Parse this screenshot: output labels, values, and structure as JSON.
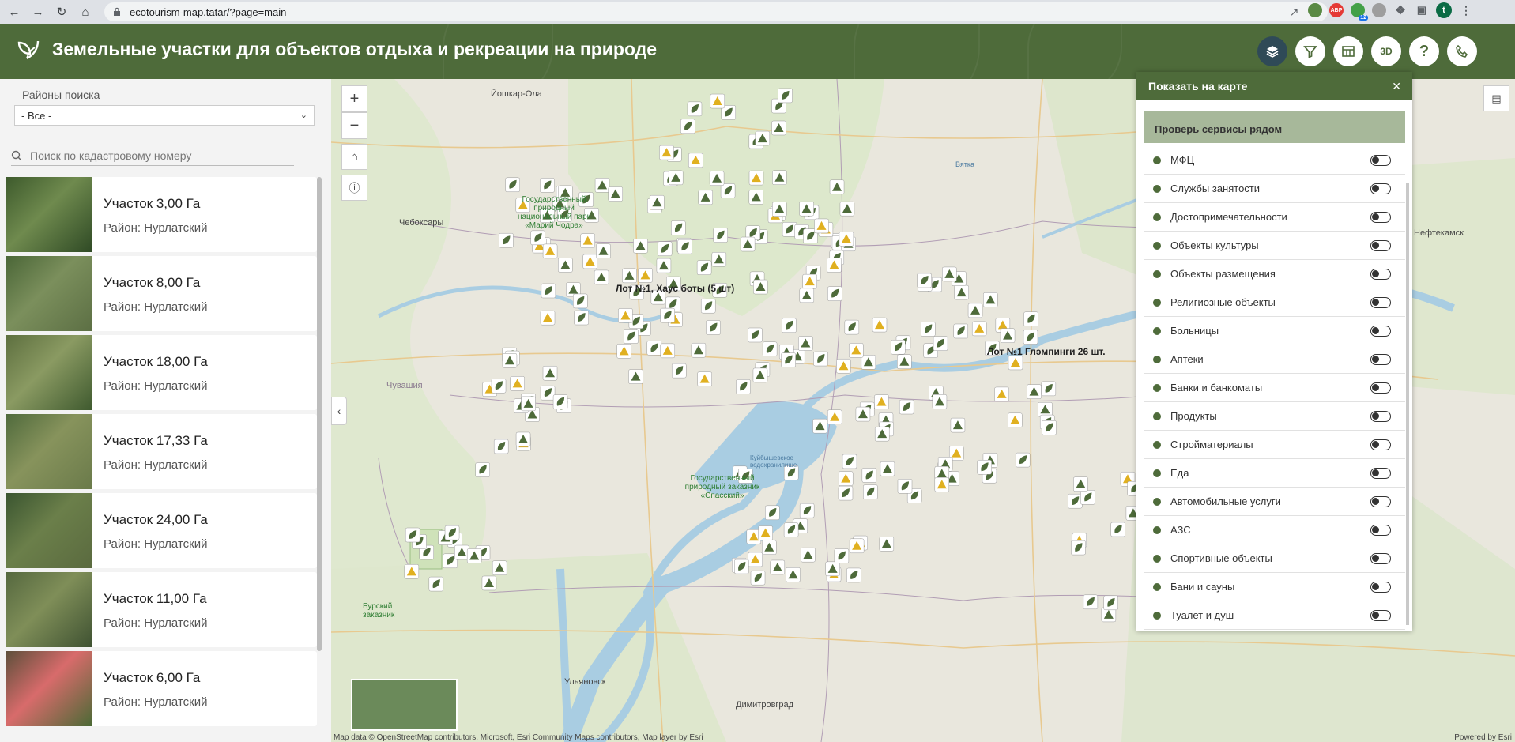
{
  "browser": {
    "url": "ecotourism-map.tatar/?page=main",
    "ext_badge": "ABP",
    "ext_count": "12",
    "profile_initial": "t"
  },
  "header": {
    "title": "Земельные участки для объектов отдыха и рекреации на природе",
    "tools": [
      "layers-icon",
      "filter-icon",
      "table-icon",
      "3D",
      "help-icon",
      "phone-icon"
    ],
    "accent": "#4e6b3a"
  },
  "sidebar": {
    "district_label": "Районы поиска",
    "district_value": "- Все -",
    "search_placeholder": "Поиск по кадастровому номеру",
    "items": [
      {
        "title": "Участок 3,00 Га",
        "district": "Район: Нурлатский"
      },
      {
        "title": "Участок 8,00 Га",
        "district": "Район: Нурлатский"
      },
      {
        "title": "Участок 18,00 Га",
        "district": "Район: Нурлатский"
      },
      {
        "title": "Участок 17,33 Га",
        "district": "Район: Нурлатский"
      },
      {
        "title": "Участок 24,00 Га",
        "district": "Район: Нурлатский"
      },
      {
        "title": "Участок 11,00 Га",
        "district": "Район: Нурлатский"
      },
      {
        "title": "Участок 6,00 Га",
        "district": "Район: Нурлатский"
      }
    ]
  },
  "map": {
    "labels": {
      "yoshkar_ola": "Йошкар-Ола",
      "cheboksary": "Чебоксары",
      "park_mariy": "Государственный природный национальный парк «Марий Чодра»",
      "chuvashia": "Чувашия",
      "kuib_res": "Куйбышевское водохранилище",
      "zapovednik": "Государственный природный заказник «Спасский»",
      "burskiy": "Бурский заказник",
      "ulyanovsk": "Ульяновск",
      "dimitrovgrad": "Димитровград",
      "neftekamsk": "Нефтекамск",
      "vyatka": "Вятка",
      "lot1": "Лот №1, Хаус боты (5 шт)",
      "lot2": "Лот №1 Глэмпинги 26 шт."
    },
    "attribution": "Map data © OpenStreetMap contributors, Microsoft, Esri Community Maps contributors, Map layer by Esri",
    "powered": "Powered by Esri"
  },
  "panel": {
    "title": "Показать на карте",
    "subtitle": "Проверь сервисы рядом",
    "layers": [
      {
        "label": "МФЦ",
        "icon": "leaf-icon"
      },
      {
        "label": "Службы занятости",
        "icon": "employment-icon"
      },
      {
        "label": "Достопримечательности",
        "icon": "landmark-icon"
      },
      {
        "label": "Объекты культуры",
        "icon": "culture-icon"
      },
      {
        "label": "Объекты размещения",
        "icon": "bed-icon"
      },
      {
        "label": "Религиозные объекты",
        "icon": "religion-icon"
      },
      {
        "label": "Больницы",
        "icon": "hospital-icon"
      },
      {
        "label": "Аптеки",
        "icon": "pharmacy-icon"
      },
      {
        "label": "Банки и банкоматы",
        "icon": "bank-icon"
      },
      {
        "label": "Продукты",
        "icon": "cart-icon"
      },
      {
        "label": "Стройматериалы",
        "icon": "tools-icon"
      },
      {
        "label": "Еда",
        "icon": "food-icon"
      },
      {
        "label": "Автомобильные услуги",
        "icon": "car-icon"
      },
      {
        "label": "АЗС",
        "icon": "fuel-icon"
      },
      {
        "label": "Спортивные объекты",
        "icon": "sport-icon"
      },
      {
        "label": "Бани и сауны",
        "icon": "sauna-icon"
      },
      {
        "label": "Туалет и душ",
        "icon": "toilet-icon"
      }
    ]
  }
}
